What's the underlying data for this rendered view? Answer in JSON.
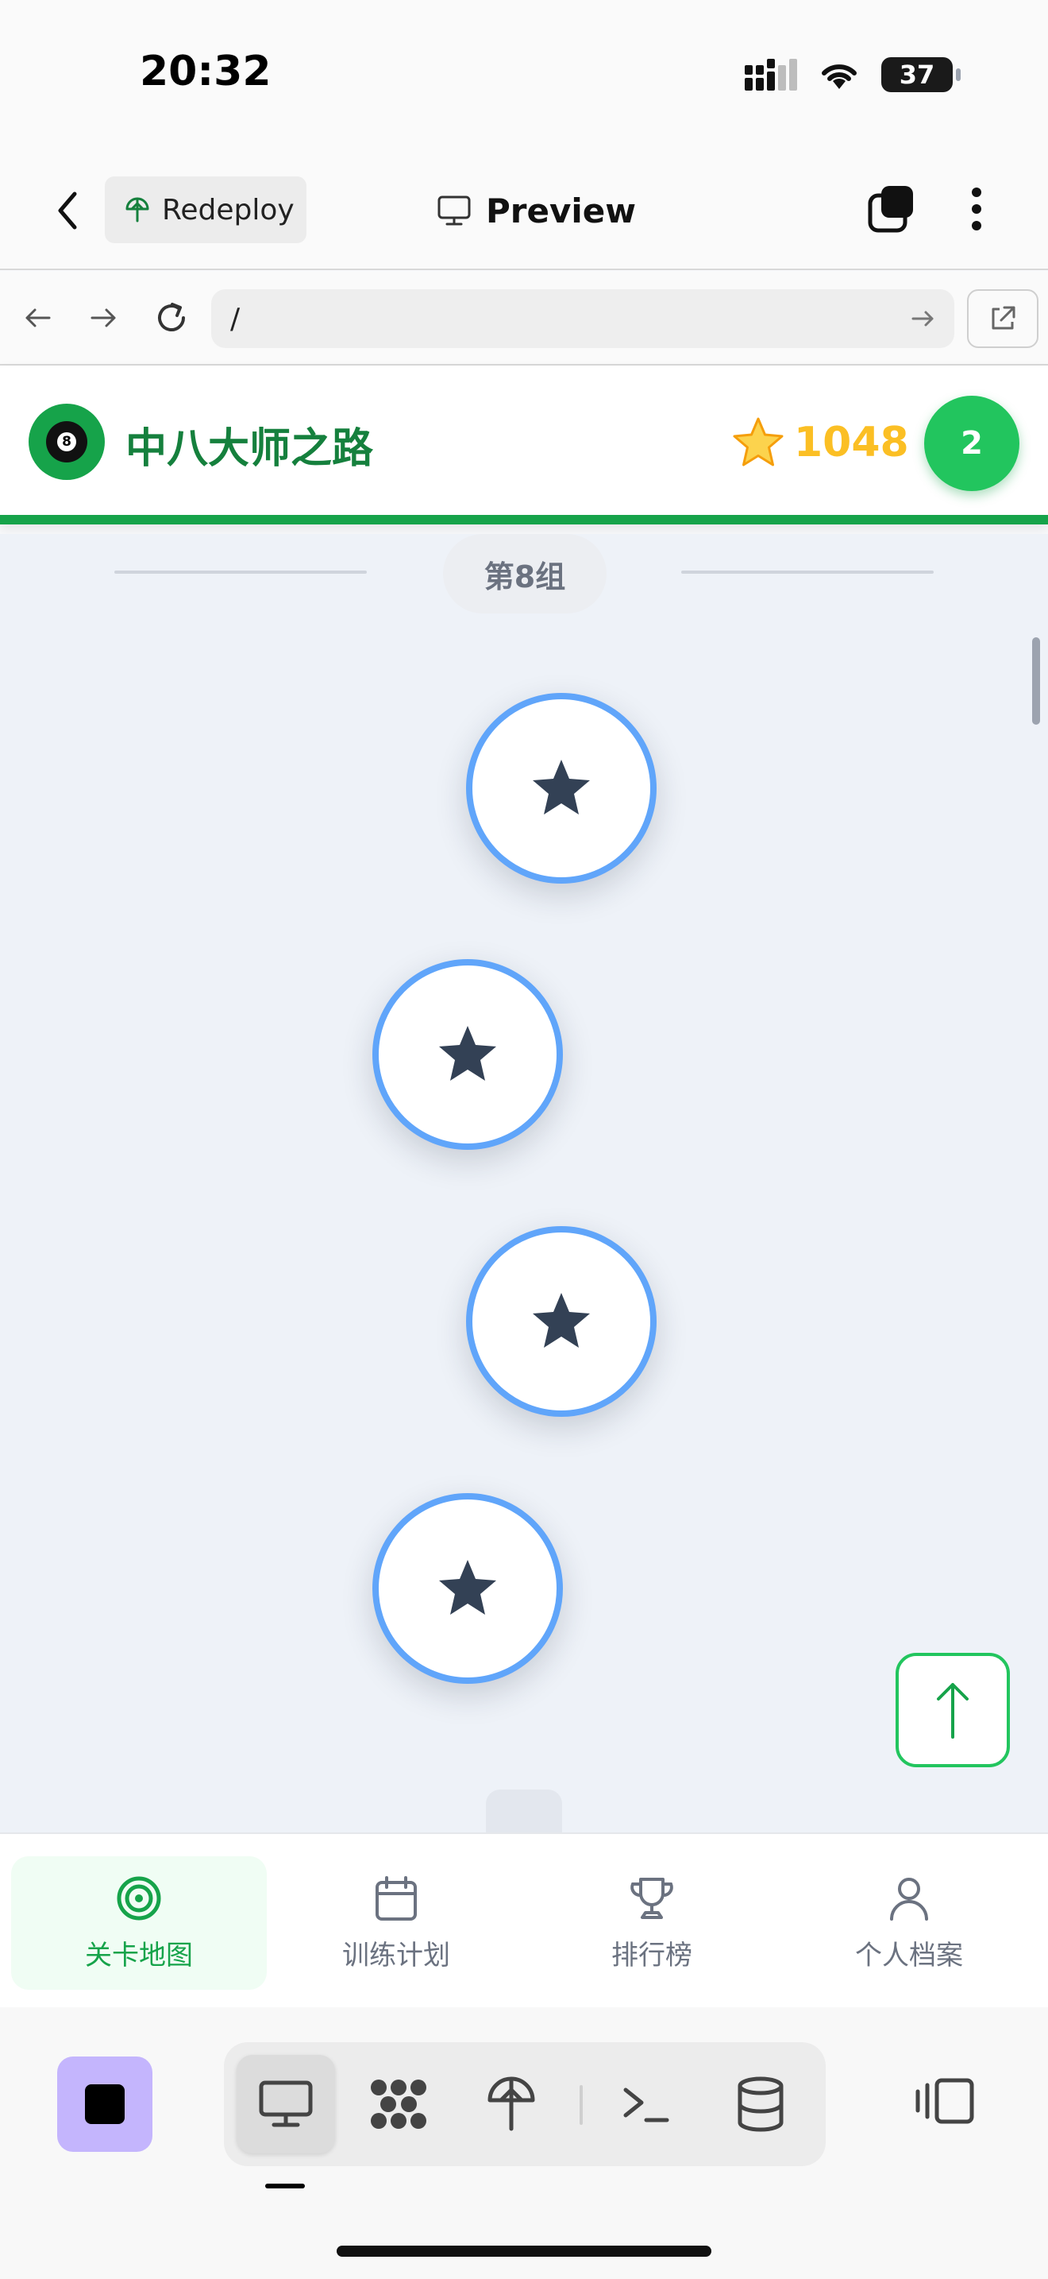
{
  "status_bar": {
    "time": "20:32",
    "battery": "37"
  },
  "app_bar": {
    "redeploy_label": "Redeploy",
    "title": "Preview"
  },
  "browser": {
    "url": "/"
  },
  "game": {
    "title": "中八大师之路",
    "score": "1048",
    "level": "2",
    "group_label": "第8组",
    "level_nodes": [
      {
        "icon": "star-icon",
        "state": "available"
      },
      {
        "icon": "star-icon",
        "state": "available"
      },
      {
        "icon": "star-icon",
        "state": "available"
      },
      {
        "icon": "star-icon",
        "state": "available"
      }
    ]
  },
  "tabs": [
    {
      "label": "关卡地图",
      "icon": "target-icon",
      "active": true
    },
    {
      "label": "训练计划",
      "icon": "calendar-icon",
      "active": false
    },
    {
      "label": "排行榜",
      "icon": "trophy-icon",
      "active": false
    },
    {
      "label": "个人档案",
      "icon": "user-icon",
      "active": false
    }
  ],
  "ide_toolbar": {
    "tools": [
      "monitor-icon",
      "grid-dots-icon",
      "deploy-icon",
      "terminal-icon",
      "database-icon"
    ]
  },
  "colors": {
    "brand_green": "#16a34a",
    "node_border": "#60a5fa",
    "score_gold": "#fbbf24",
    "stop_button": "#c4b5fd"
  }
}
